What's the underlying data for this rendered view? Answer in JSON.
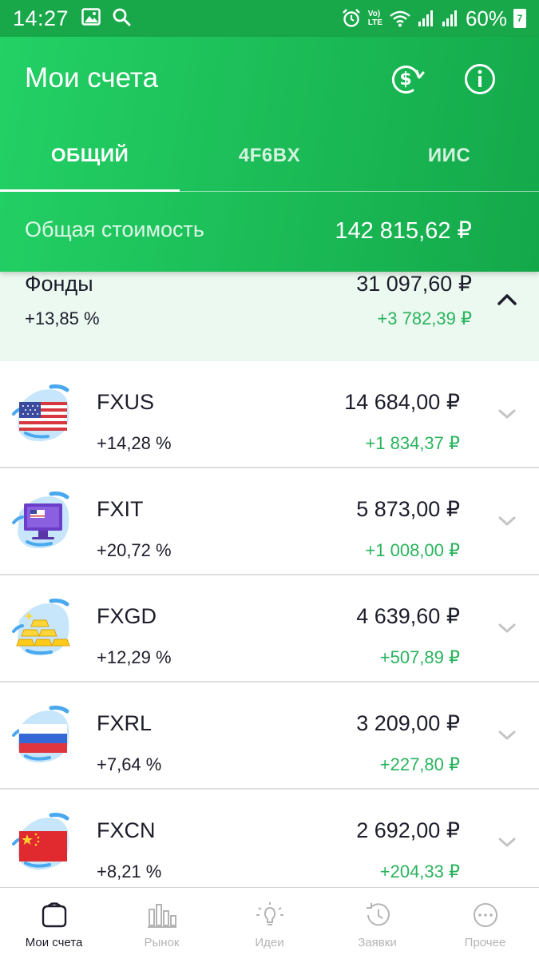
{
  "status_bar": {
    "time": "14:27",
    "battery": "60%",
    "battery_level": "7",
    "volte_top": "Vo)",
    "volte_bottom": "LTE"
  },
  "header": {
    "title": "Мои счета",
    "icons": [
      "currency-exchange-icon",
      "info-icon"
    ]
  },
  "tabs": [
    {
      "label": "ОБЩИЙ",
      "active": true
    },
    {
      "label": "4F6BX",
      "active": false
    },
    {
      "label": "ИИС",
      "active": false
    }
  ],
  "total": {
    "label": "Общая стоимость",
    "value": "142 815,62 ₽"
  },
  "funds_group": {
    "title": "Фонды",
    "value": "31 097,60 ₽",
    "pct": "+13,85  %",
    "gain": "+3 782,39 ₽"
  },
  "funds": [
    {
      "ticker": "FXUS",
      "value": "14 684,00 ₽",
      "pct": "+14,28  %",
      "gain": "+1 834,37 ₽",
      "icon": "us-flag-icon"
    },
    {
      "ticker": "FXIT",
      "value": "5 873,00 ₽",
      "pct": "+20,72  %",
      "gain": "+1 008,00 ₽",
      "icon": "monitor-icon"
    },
    {
      "ticker": "FXGD",
      "value": "4 639,60 ₽",
      "pct": "+12,29  %",
      "gain": "+507,89 ₽",
      "icon": "gold-bars-icon"
    },
    {
      "ticker": "FXRL",
      "value": "3 209,00 ₽",
      "pct": "+7,64  %",
      "gain": "+227,80 ₽",
      "icon": "russia-flag-icon"
    },
    {
      "ticker": "FXCN",
      "value": "2 692,00 ₽",
      "pct": "+8,21  %",
      "gain": "+204,33 ₽",
      "icon": "china-flag-icon"
    }
  ],
  "bottom_nav": [
    {
      "label": "Мои счета",
      "icon": "wallet-icon",
      "active": true
    },
    {
      "label": "Рынок",
      "icon": "bar-chart-icon",
      "active": false
    },
    {
      "label": "Идеи",
      "icon": "lightbulb-icon",
      "active": false
    },
    {
      "label": "Заявки",
      "icon": "history-icon",
      "active": false
    },
    {
      "label": "Прочее",
      "icon": "more-icon",
      "active": false
    }
  ],
  "colors": {
    "header_green": "#1fbf58",
    "status_green": "#18a84a",
    "gain_green": "#2ab35d",
    "funds_bg": "#ebf9f0"
  }
}
